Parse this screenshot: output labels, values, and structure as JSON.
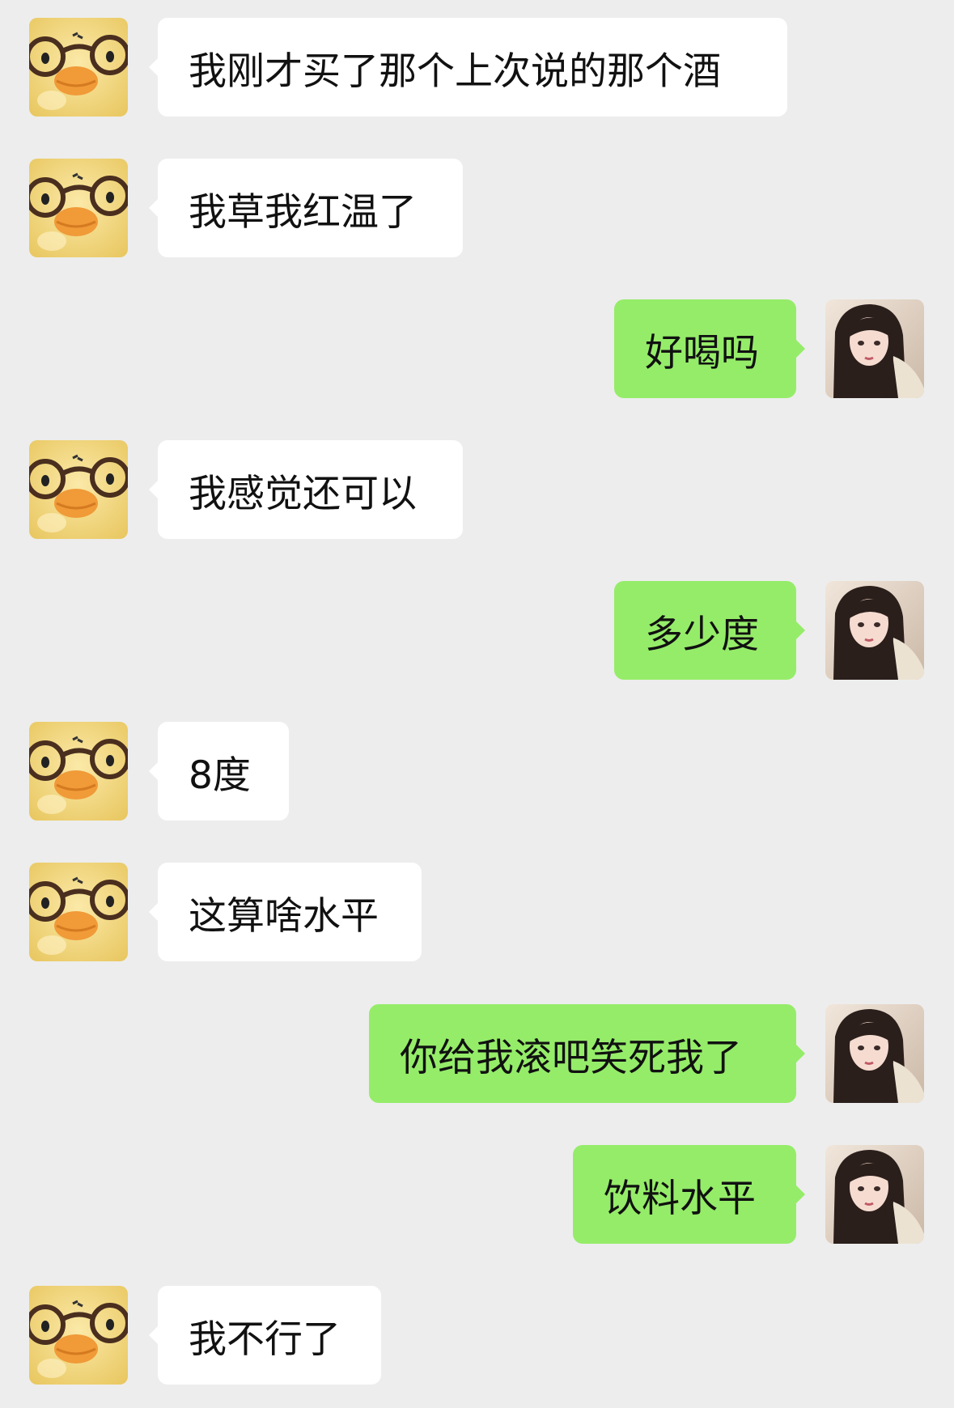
{
  "colors": {
    "background": "#ededed",
    "incoming_bubble": "#ffffff",
    "outgoing_bubble": "#95ec69",
    "text": "#111111"
  },
  "contact_avatar_icon": "duck-with-glasses-avatar-icon",
  "self_avatar_icon": "girl-portrait-avatar-icon",
  "messages": [
    {
      "sender": "contact",
      "text": "我刚才买了那个上次说的那个酒"
    },
    {
      "sender": "contact",
      "text": "我草我红温了"
    },
    {
      "sender": "self",
      "text": "好喝吗"
    },
    {
      "sender": "contact",
      "text": "我感觉还可以"
    },
    {
      "sender": "self",
      "text": "多少度"
    },
    {
      "sender": "contact",
      "text": "8度"
    },
    {
      "sender": "contact",
      "text": "这算啥水平"
    },
    {
      "sender": "self",
      "text": "你给我滚吧笑死我了"
    },
    {
      "sender": "self",
      "text": "饮料水平"
    },
    {
      "sender": "contact",
      "text": "我不行了"
    }
  ]
}
